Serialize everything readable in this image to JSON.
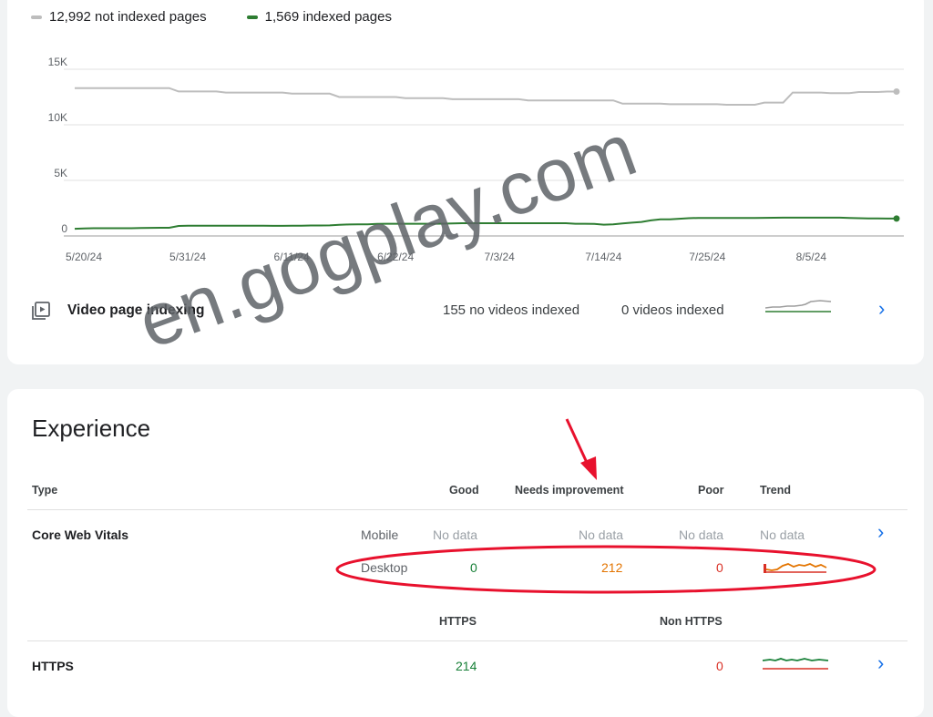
{
  "indexing": {
    "legend": {
      "not_indexed": "12,992 not indexed pages",
      "indexed": "1,569 indexed pages"
    },
    "video": {
      "label": "Video page indexing",
      "no_videos": "155 no videos indexed",
      "videos": "0 videos indexed"
    }
  },
  "colors": {
    "not_indexed": "#bdbdbd",
    "indexed": "#2e7d32",
    "good": "#188038",
    "needs_improvement": "#e37400",
    "poor": "#d93025",
    "link": "#1a73e8"
  },
  "chart_data": {
    "type": "line",
    "x": [
      "5/20/24",
      "5/21/24",
      "5/22/24",
      "5/23/24",
      "5/24/24",
      "5/25/24",
      "5/26/24",
      "5/27/24",
      "5/28/24",
      "5/29/24",
      "5/30/24",
      "5/31/24",
      "6/1/24",
      "6/2/24",
      "6/3/24",
      "6/4/24",
      "6/5/24",
      "6/6/24",
      "6/7/24",
      "6/8/24",
      "6/9/24",
      "6/10/24",
      "6/11/24",
      "6/12/24",
      "6/13/24",
      "6/14/24",
      "6/15/24",
      "6/16/24",
      "6/17/24",
      "6/18/24",
      "6/19/24",
      "6/20/24",
      "6/21/24",
      "6/22/24",
      "6/23/24",
      "6/24/24",
      "6/25/24",
      "6/26/24",
      "6/27/24",
      "6/28/24",
      "6/29/24",
      "6/30/24",
      "7/1/24",
      "7/2/24",
      "7/3/24",
      "7/4/24",
      "7/5/24",
      "7/6/24",
      "7/7/24",
      "7/8/24",
      "7/9/24",
      "7/10/24",
      "7/11/24",
      "7/12/24",
      "7/13/24",
      "7/14/24",
      "7/15/24",
      "7/16/24",
      "7/17/24",
      "7/18/24",
      "7/19/24",
      "7/20/24",
      "7/21/24",
      "7/22/24",
      "7/23/24",
      "7/24/24",
      "7/25/24",
      "7/26/24",
      "7/27/24",
      "7/28/24",
      "7/29/24",
      "7/30/24",
      "7/31/24",
      "8/1/24",
      "8/2/24",
      "8/3/24",
      "8/4/24",
      "8/5/24",
      "8/6/24",
      "8/7/24",
      "8/8/24",
      "8/9/24",
      "8/10/24",
      "8/11/24",
      "8/12/24",
      "8/13/24",
      "8/14/24",
      "8/15/24"
    ],
    "series": [
      {
        "name": "not indexed pages",
        "values": [
          13300,
          13300,
          13300,
          13300,
          13300,
          13300,
          13300,
          13300,
          13300,
          13300,
          13300,
          13000,
          13000,
          13000,
          13000,
          13000,
          12900,
          12900,
          12900,
          12900,
          12900,
          12900,
          12900,
          12800,
          12800,
          12800,
          12800,
          12800,
          12500,
          12500,
          12500,
          12500,
          12500,
          12500,
          12500,
          12400,
          12400,
          12400,
          12400,
          12400,
          12300,
          12300,
          12300,
          12300,
          12300,
          12300,
          12300,
          12300,
          12200,
          12200,
          12200,
          12200,
          12200,
          12200,
          12200,
          12200,
          12200,
          12200,
          11900,
          11900,
          11900,
          11900,
          11900,
          11850,
          11850,
          11850,
          11850,
          11850,
          11850,
          11800,
          11800,
          11800,
          11800,
          12000,
          12000,
          12000,
          12900,
          12900,
          12900,
          12900,
          12850,
          12850,
          12850,
          12950,
          12950,
          12950,
          12992,
          12992
        ]
      },
      {
        "name": "indexed pages",
        "values": [
          650,
          680,
          700,
          700,
          700,
          700,
          700,
          720,
          730,
          740,
          740,
          900,
          920,
          930,
          930,
          930,
          930,
          930,
          930,
          920,
          920,
          910,
          910,
          920,
          930,
          940,
          940,
          950,
          1000,
          1030,
          1040,
          1050,
          1080,
          1100,
          1100,
          1100,
          1100,
          1100,
          1100,
          1110,
          1120,
          1150,
          1150,
          1150,
          1150,
          1150,
          1150,
          1150,
          1150,
          1150,
          1150,
          1150,
          1150,
          1100,
          1100,
          1080,
          1020,
          1050,
          1120,
          1200,
          1260,
          1400,
          1500,
          1500,
          1550,
          1600,
          1620,
          1620,
          1620,
          1620,
          1620,
          1620,
          1620,
          1630,
          1640,
          1650,
          1650,
          1650,
          1650,
          1650,
          1650,
          1650,
          1620,
          1600,
          1580,
          1570,
          1569,
          1569
        ]
      }
    ],
    "xticks": [
      "5/20/24",
      "5/31/24",
      "6/11/24",
      "6/22/24",
      "7/3/24",
      "7/14/24",
      "7/25/24",
      "8/5/24"
    ],
    "yticks": [
      "0",
      "5K",
      "10K",
      "15K"
    ],
    "ylim": [
      0,
      15000
    ]
  },
  "experience": {
    "title": "Experience",
    "headers": {
      "type": "Type",
      "good": "Good",
      "needs_improvement": "Needs improvement",
      "poor": "Poor",
      "trend": "Trend"
    },
    "core_web_vitals": {
      "label": "Core Web Vitals",
      "mobile": {
        "device": "Mobile",
        "good": "No data",
        "needs_improvement": "No data",
        "poor": "No data",
        "trend": "No data"
      },
      "desktop": {
        "device": "Desktop",
        "good": "0",
        "needs_improvement": "212",
        "poor": "0"
      }
    },
    "https_headers": {
      "https": "HTTPS",
      "non_https": "Non HTTPS"
    },
    "https": {
      "label": "HTTPS",
      "https": "214",
      "non_https": "0"
    }
  },
  "watermark": "en.gogplay.com"
}
